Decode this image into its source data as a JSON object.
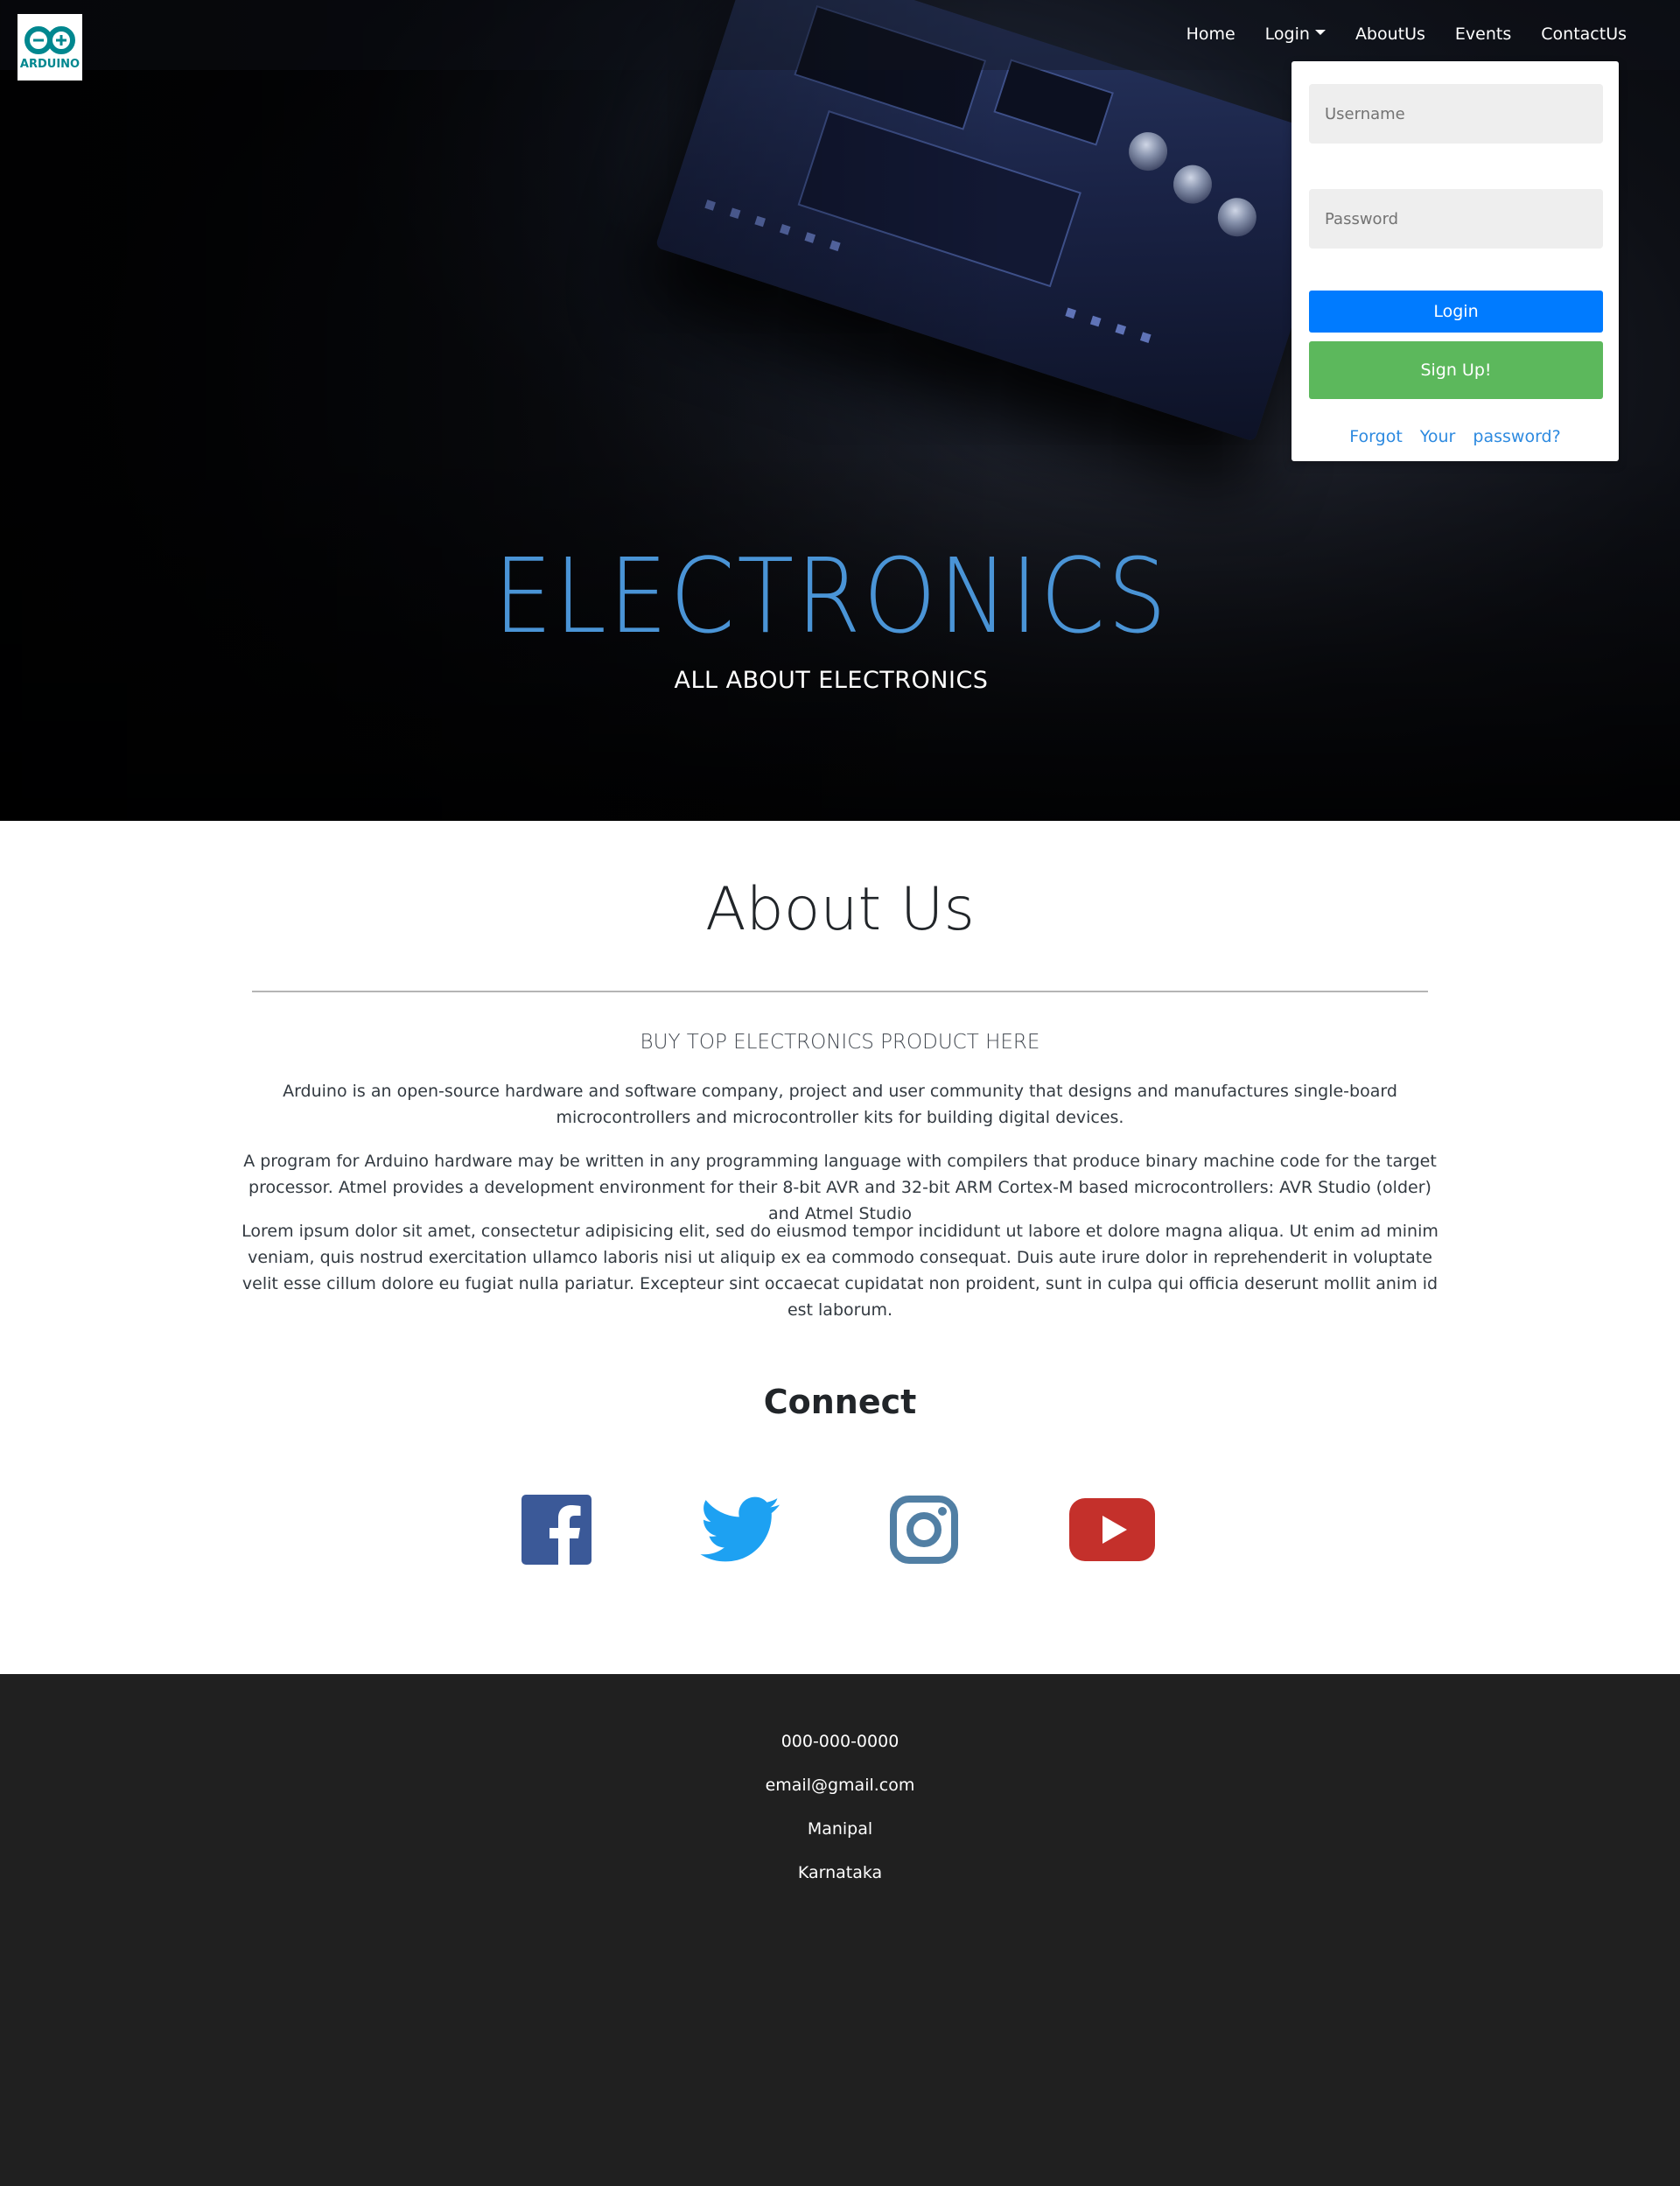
{
  "brand": {
    "logo_text": "ARDUINO"
  },
  "nav": {
    "items": [
      {
        "label": "Home"
      },
      {
        "label": "Login"
      },
      {
        "label": "AboutUs"
      },
      {
        "label": "Events"
      },
      {
        "label": "ContactUs"
      }
    ]
  },
  "login_dropdown": {
    "username_placeholder": "Username",
    "password_placeholder": "Password",
    "login_button": "Login",
    "signup_button": "Sign Up!",
    "forgot_link": "Forgot Your password?"
  },
  "hero": {
    "title": "ELECTRONICS",
    "subtitle": "ALL ABOUT ELECTRONICS"
  },
  "about": {
    "title": "About Us",
    "subtitle": "BUY TOP ELECTRONICS PRODUCT HERE",
    "paragraphs": [
      "Arduino is an open-source hardware and software company, project and user community that designs and manufactures single-board microcontrollers and microcontroller kits for building digital devices.",
      "A program for Arduino hardware may be written in any programming language with compilers that produce binary machine code for the target processor. Atmel provides a development environment for their 8-bit AVR and 32-bit ARM Cortex-M based microcontrollers: AVR Studio (older) and Atmel Studio",
      "Lorem ipsum dolor sit amet, consectetur adipisicing elit, sed do eiusmod tempor incididunt ut labore et dolore magna aliqua. Ut enim ad minim veniam, quis nostrud exercitation ullamco laboris nisi ut aliquip ex ea commodo consequat. Duis aute irure dolor in reprehenderit in voluptate velit esse cillum dolore eu fugiat nulla pariatur. Excepteur sint occaecat cupidatat non proident, sunt in culpa qui officia deserunt mollit anim id est laborum."
    ]
  },
  "connect": {
    "title": "Connect",
    "icons": [
      "facebook-icon",
      "twitter-icon",
      "instagram-icon",
      "youtube-icon"
    ]
  },
  "footer": {
    "phone": "000-000-0000",
    "email": "email@gmail.com",
    "city": "Manipal",
    "state": "Karnataka"
  },
  "colors": {
    "primary": "#007bff",
    "success": "#5cb85c",
    "hero_title": "#4a94d6",
    "footer_bg": "#202020",
    "facebook": "#3b5998",
    "twitter": "#1da1f2",
    "instagram": "#517fa4",
    "youtube": "#c4302b"
  }
}
